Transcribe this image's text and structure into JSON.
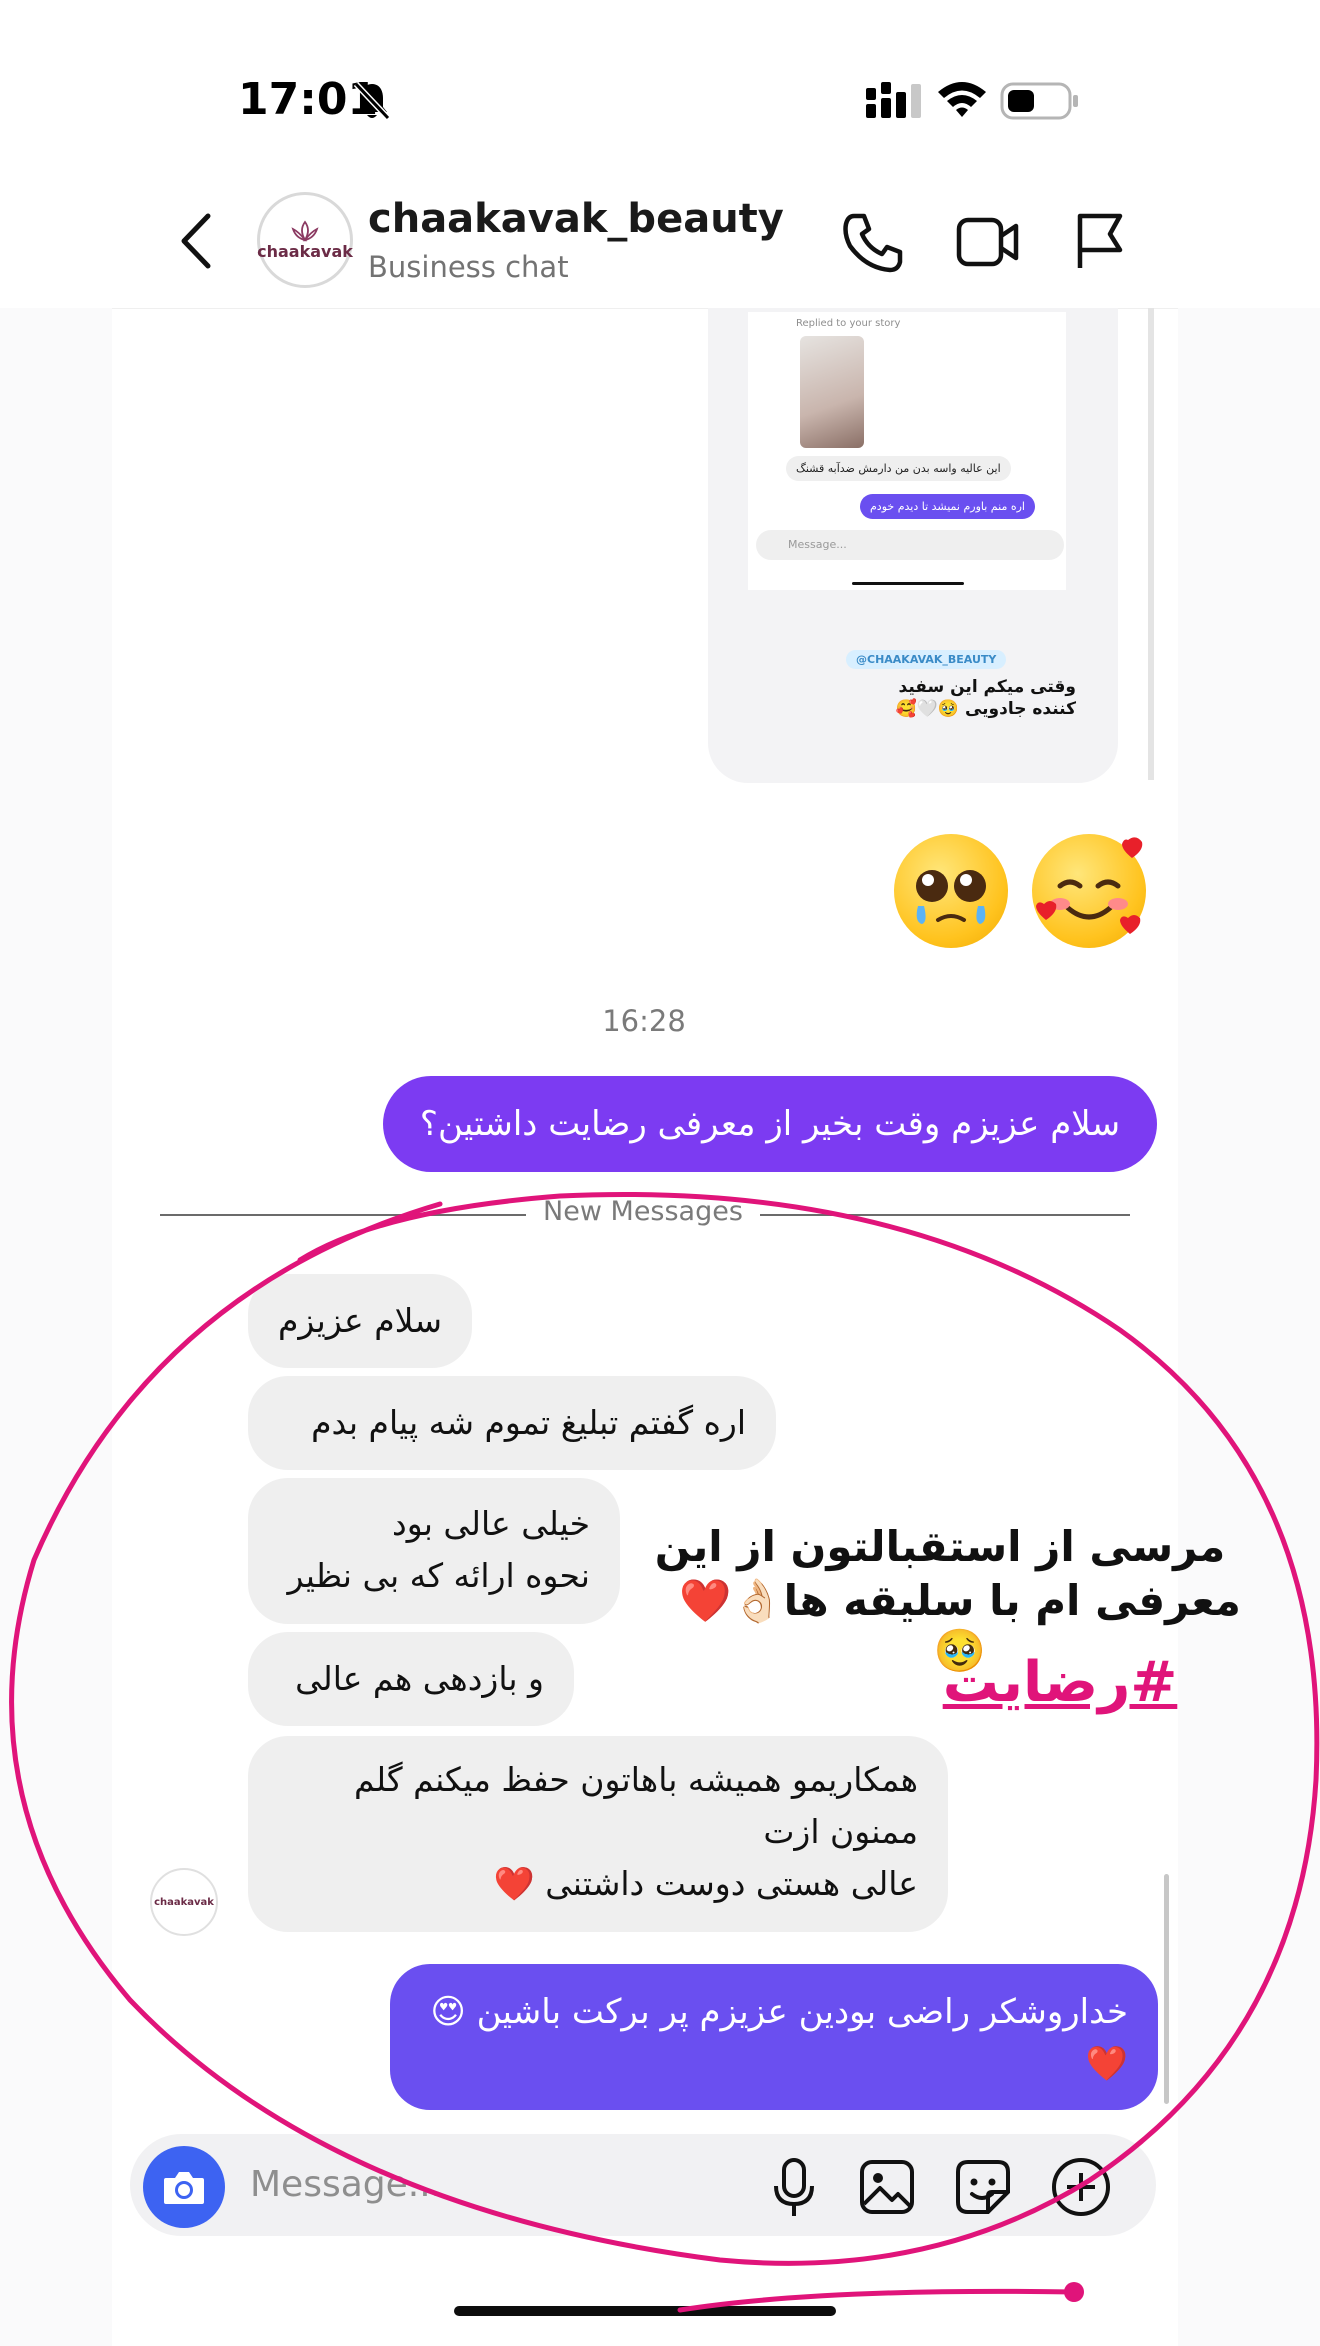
{
  "status_bar": {
    "time": "17:01"
  },
  "header": {
    "avatar_logo": "chaakavak",
    "username": "chaakavak_beauty",
    "subtitle": "Business chat"
  },
  "shared_story": {
    "replied_label": "Replied to your story",
    "mini_incoming": "این عالیه واسه بدن من دارمش ضدآبه قشنگ",
    "mini_outgoing": "اره منم باورم نمیشد تا دیدم خودم",
    "mini_placeholder": "Message...",
    "tag": "@CHAAKAVAK_BEAUTY",
    "caption": "وقتی میکم این سفید کننده جادویی 🥹🤍🥰"
  },
  "emoji_row": [
    "🥹",
    "🥰"
  ],
  "timestamp": "16:28",
  "messages": {
    "outgoing_1": "سلام عزیزم وقت بخیر از معرفی رضایت داشتین؟",
    "new_messages_label": "New Messages",
    "incoming": [
      "سلام عزیزم",
      "اره گفتم تبلیغ تموم شه پیام بدم",
      "خیلی عالی بود\nنحوه ارائه که بی نظیر",
      "و بازدهی هم عالی",
      "همکاریمو همیشه باهاتون  حفظ میکنم گلم\nممنون ازت\nعالی هستی دوست داشتنی ❤️"
    ],
    "outgoing_2": "خداروشکر راضی بودین عزیزم پر برکت باشین 😍❤️"
  },
  "composer": {
    "placeholder": "Message..."
  },
  "overlay": {
    "line1": "مرسی از استقبالتون از این",
    "line2": "معرفی ام با سلیقه ها👌🏻❤️🥹",
    "hashtag": "#رضایت",
    "color": "#e0147a"
  },
  "colors": {
    "outgoing_bubble": "#7c3bf2",
    "outgoing_bubble_2": "#6a4ff0",
    "incoming_bubble": "#efefef",
    "camera_button": "#3d63f2"
  }
}
